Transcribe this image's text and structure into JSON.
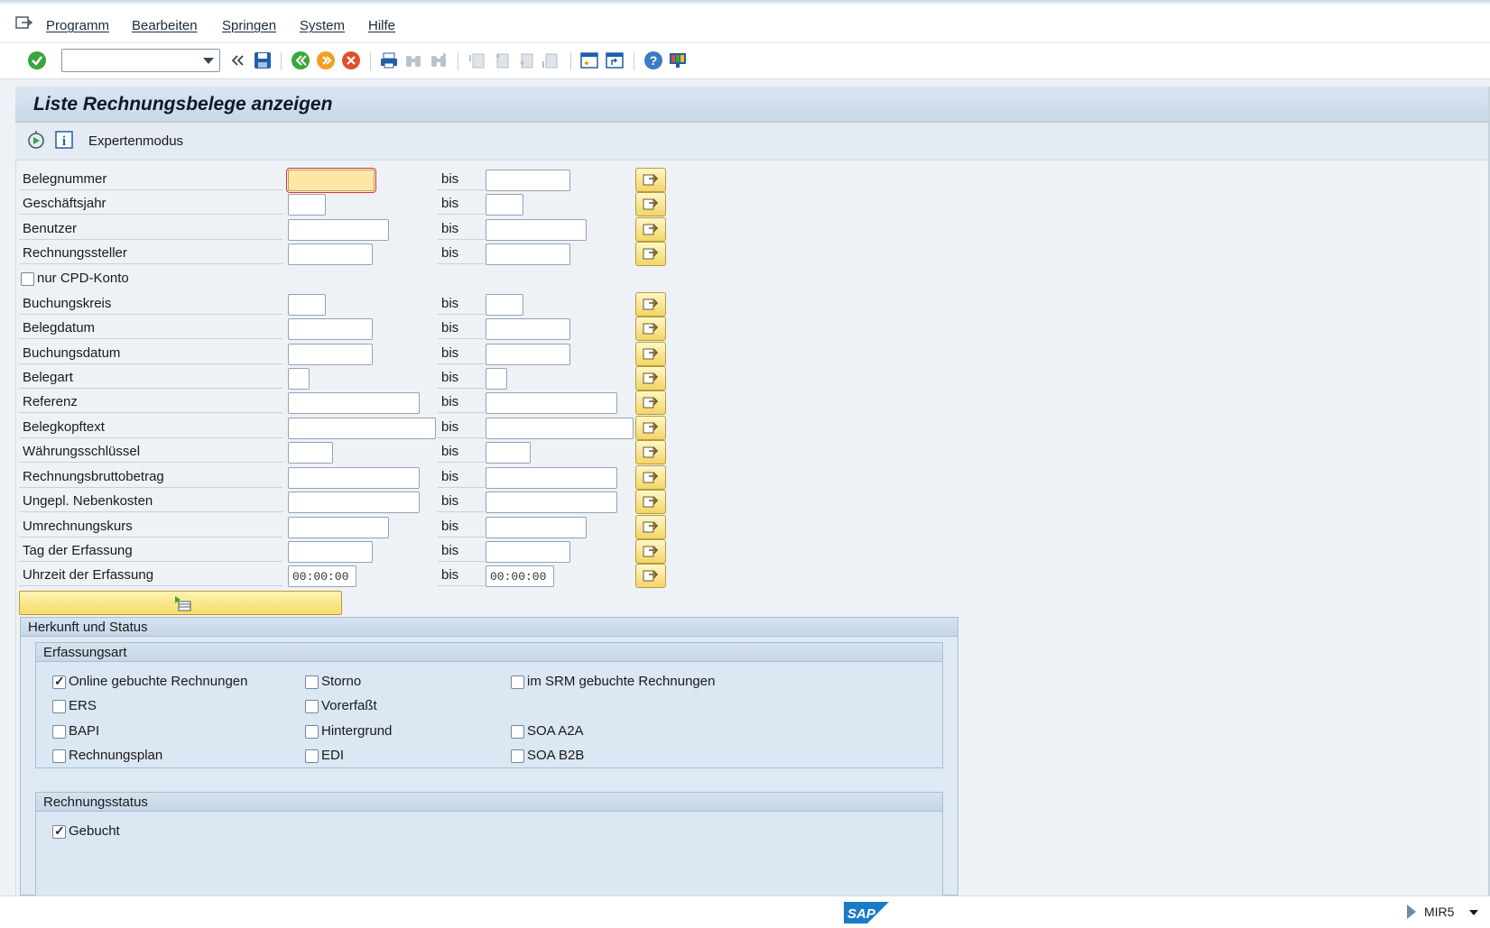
{
  "menu": [
    "Programm",
    "Bearbeiten",
    "Springen",
    "System",
    "Hilfe"
  ],
  "toolbar_icons": [
    "enter-icon",
    "back-icon",
    "exit-icon",
    "cancel-icon",
    "print-icon",
    "find-icon",
    "find-next-icon",
    "first-page-icon",
    "previous-page-icon",
    "next-page-icon",
    "last-page-icon",
    "new-session-icon",
    "shortcut-icon",
    "help-icon",
    "customize-layout-icon"
  ],
  "page_title": "Liste Rechnungsbelege anzeigen",
  "app_toolbar": {
    "expert_label": "Expertenmodus"
  },
  "bis_label": "bis",
  "fields": [
    {
      "label": "Belegnummer",
      "from": "",
      "to": ""
    },
    {
      "label": "Geschäftsjahr",
      "from": "",
      "to": ""
    },
    {
      "label": "Benutzer",
      "from": "",
      "to": ""
    },
    {
      "label": "Rechnungssteller",
      "from": "",
      "to": ""
    },
    {
      "label": "Buchungskreis",
      "from": "",
      "to": ""
    },
    {
      "label": "Belegdatum",
      "from": "",
      "to": ""
    },
    {
      "label": "Buchungsdatum",
      "from": "",
      "to": ""
    },
    {
      "label": "Belegart",
      "from": "",
      "to": ""
    },
    {
      "label": "Referenz",
      "from": "",
      "to": ""
    },
    {
      "label": "Belegkopftext",
      "from": "",
      "to": ""
    },
    {
      "label": "Währungsschlüssel",
      "from": "",
      "to": ""
    },
    {
      "label": "Rechnungsbruttobetrag",
      "from": "",
      "to": ""
    },
    {
      "label": "Ungepl. Nebenkosten",
      "from": "",
      "to": ""
    },
    {
      "label": "Umrechnungskurs",
      "from": "",
      "to": ""
    },
    {
      "label": "Tag der Erfassung",
      "from": "",
      "to": ""
    },
    {
      "label": "Uhrzeit der Erfassung",
      "from": "00:00:00",
      "to": "00:00:00"
    }
  ],
  "cpd_checkbox": {
    "label": "nur CPD-Konto",
    "checked": false
  },
  "group_herkunft": {
    "title": "Herkunft und Status",
    "erfassungsart": {
      "title": "Erfassungsart",
      "items": [
        {
          "label": "Online gebuchte Rechnungen",
          "checked": true
        },
        {
          "label": "Storno",
          "checked": false
        },
        {
          "label": "im SRM gebuchte Rechnungen",
          "checked": false
        },
        {
          "label": "ERS",
          "checked": false
        },
        {
          "label": "Vorerfaßt",
          "checked": false
        },
        {
          "label": "BAPI",
          "checked": false
        },
        {
          "label": "Hintergrund",
          "checked": false
        },
        {
          "label": "SOA A2A",
          "checked": false
        },
        {
          "label": "Rechnungsplan",
          "checked": false
        },
        {
          "label": "EDI",
          "checked": false
        },
        {
          "label": "SOA B2B",
          "checked": false
        }
      ]
    },
    "rechnungsstatus": {
      "title": "Rechnungsstatus",
      "items": [
        {
          "label": "Gebucht",
          "checked": true
        }
      ]
    }
  },
  "statusbar": {
    "logo": "SAP",
    "transaction": "MIR5"
  }
}
